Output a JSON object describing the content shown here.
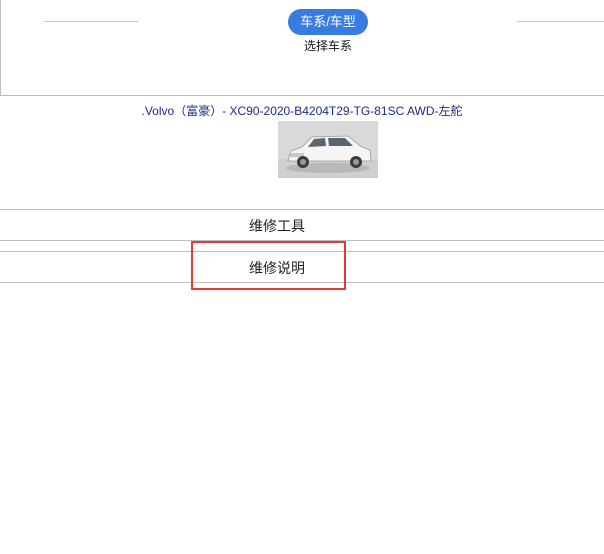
{
  "steps": {
    "active_label": "车系/车型",
    "caption": "选择车系"
  },
  "vehicle": {
    "title": ".Volvo（富豪）- XC90-2020-B4204T29-TG-81SC AWD-左舵",
    "image": "white-suv-thumbnail"
  },
  "menu": {
    "items": [
      {
        "label": "维修工具"
      },
      {
        "label": "维修说明"
      }
    ]
  },
  "colors": {
    "accent": "#3a7be0",
    "highlight": "#e03c3c",
    "title_link": "#1f2a8c"
  }
}
